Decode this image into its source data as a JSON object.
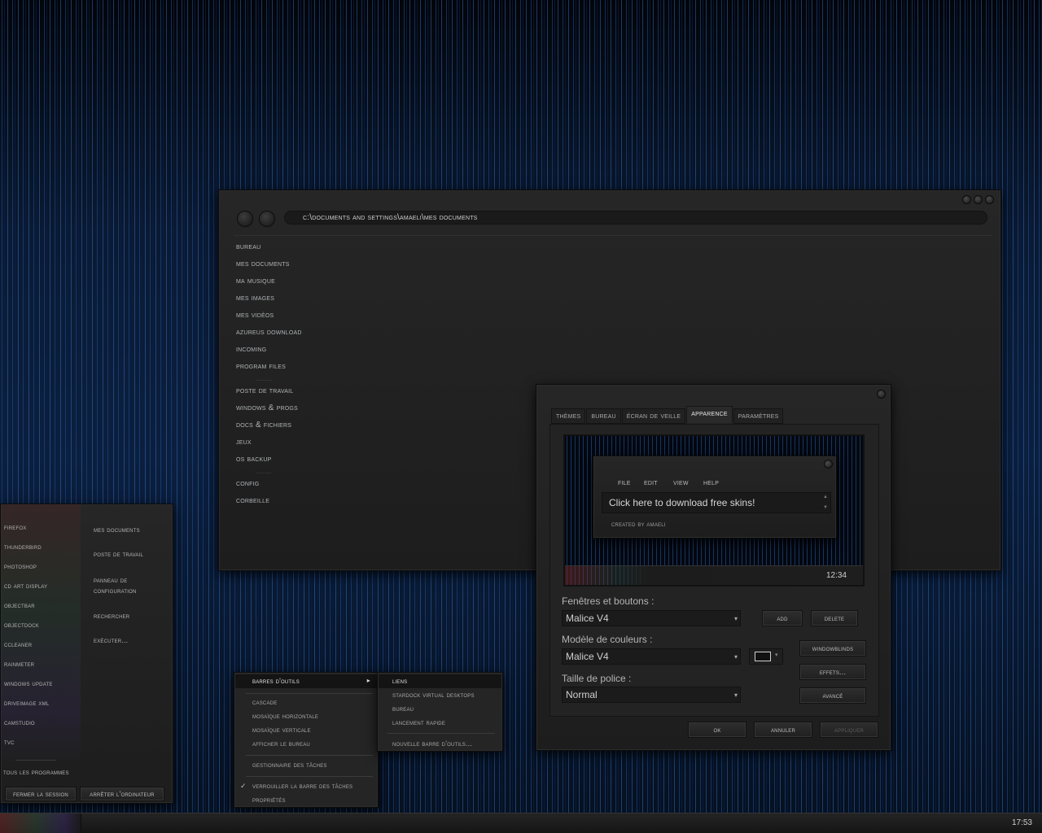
{
  "explorer": {
    "address": "C:\\Documents and Settings\\Amaeli\\Mes documents",
    "nav_top": [
      "Bureau",
      "Mes documents",
      "Ma musique",
      "Mes images",
      "Mes vidéos",
      "Azureus Download",
      "Incoming",
      "Program Files"
    ],
    "nav_mid": [
      "Poste de travail",
      "Windows & Progs",
      "Docs & Fichiers",
      "Jeux",
      "OS Backup"
    ],
    "nav_bottom": [
      "Config",
      "Corbeille"
    ],
    "dots": "........."
  },
  "dialog": {
    "tabs": [
      "Thèmes",
      "Bureau",
      "Écran de veille",
      "Apparence",
      "Paramètres"
    ],
    "active_tab": "Apparence",
    "preview": {
      "menu": [
        "File",
        "Edit",
        "View",
        "Help"
      ],
      "text": "Click here to download free skins!",
      "credit": "Created by amaeli",
      "clock": "12:34"
    },
    "windows_label": "Fenêtres et boutons :",
    "windows_value": "Malice V4",
    "colors_label": "Modèle de couleurs :",
    "colors_value": "Malice V4",
    "font_label": "Taille de police :",
    "font_value": "Normal",
    "buttons": {
      "add": "Add",
      "delete": "Delete",
      "windowblinds": "WindowBlinds",
      "effects": "Effets...",
      "advanced": "Avancé",
      "ok": "OK",
      "cancel": "Annuler",
      "apply": "Appliquer"
    }
  },
  "startmenu": {
    "programs": [
      "Firefox",
      "Thunderbird",
      "Photoshop",
      "CD Art Display",
      "ObjectBar",
      "ObjectDock",
      "CCleaner",
      "Rainmeter",
      "Windows Update",
      "DriveImage XML",
      "CamStudio",
      "tvc"
    ],
    "places": [
      "Mes documents",
      "Poste de travail",
      "Panneau de",
      "configuration",
      "Rechercher",
      "Exécuter..."
    ],
    "all_programs": "Tous les programmes",
    "logoff": "Fermer la session",
    "shutdown": "Arrêter l'ordinateur"
  },
  "context_menu": {
    "toolbars": "Barres d'outils",
    "cascade": "Cascade",
    "tile_h": "Mosaïque horizontale",
    "tile_v": "Mosaïque verticale",
    "show_desktop": "Afficher le Bureau",
    "task_manager": "Gestionnaire des tâches",
    "lock": "Verrouiller la Barre des tâches",
    "lock_check": "✓",
    "properties": "Propriétés",
    "submenu_arrow": "▸"
  },
  "submenu": {
    "links": "Liens",
    "stardock": "Stardock Virtual Desktops",
    "desktop": "Bureau",
    "quick_launch": "Lancement rapide",
    "new_toolbar": "Nouvelle barre d'outils..."
  },
  "taskbar": {
    "clock": "17:53"
  },
  "icons": {
    "combo_arrow": "▾",
    "scroll_up": "▲",
    "scroll_down": "▼"
  }
}
